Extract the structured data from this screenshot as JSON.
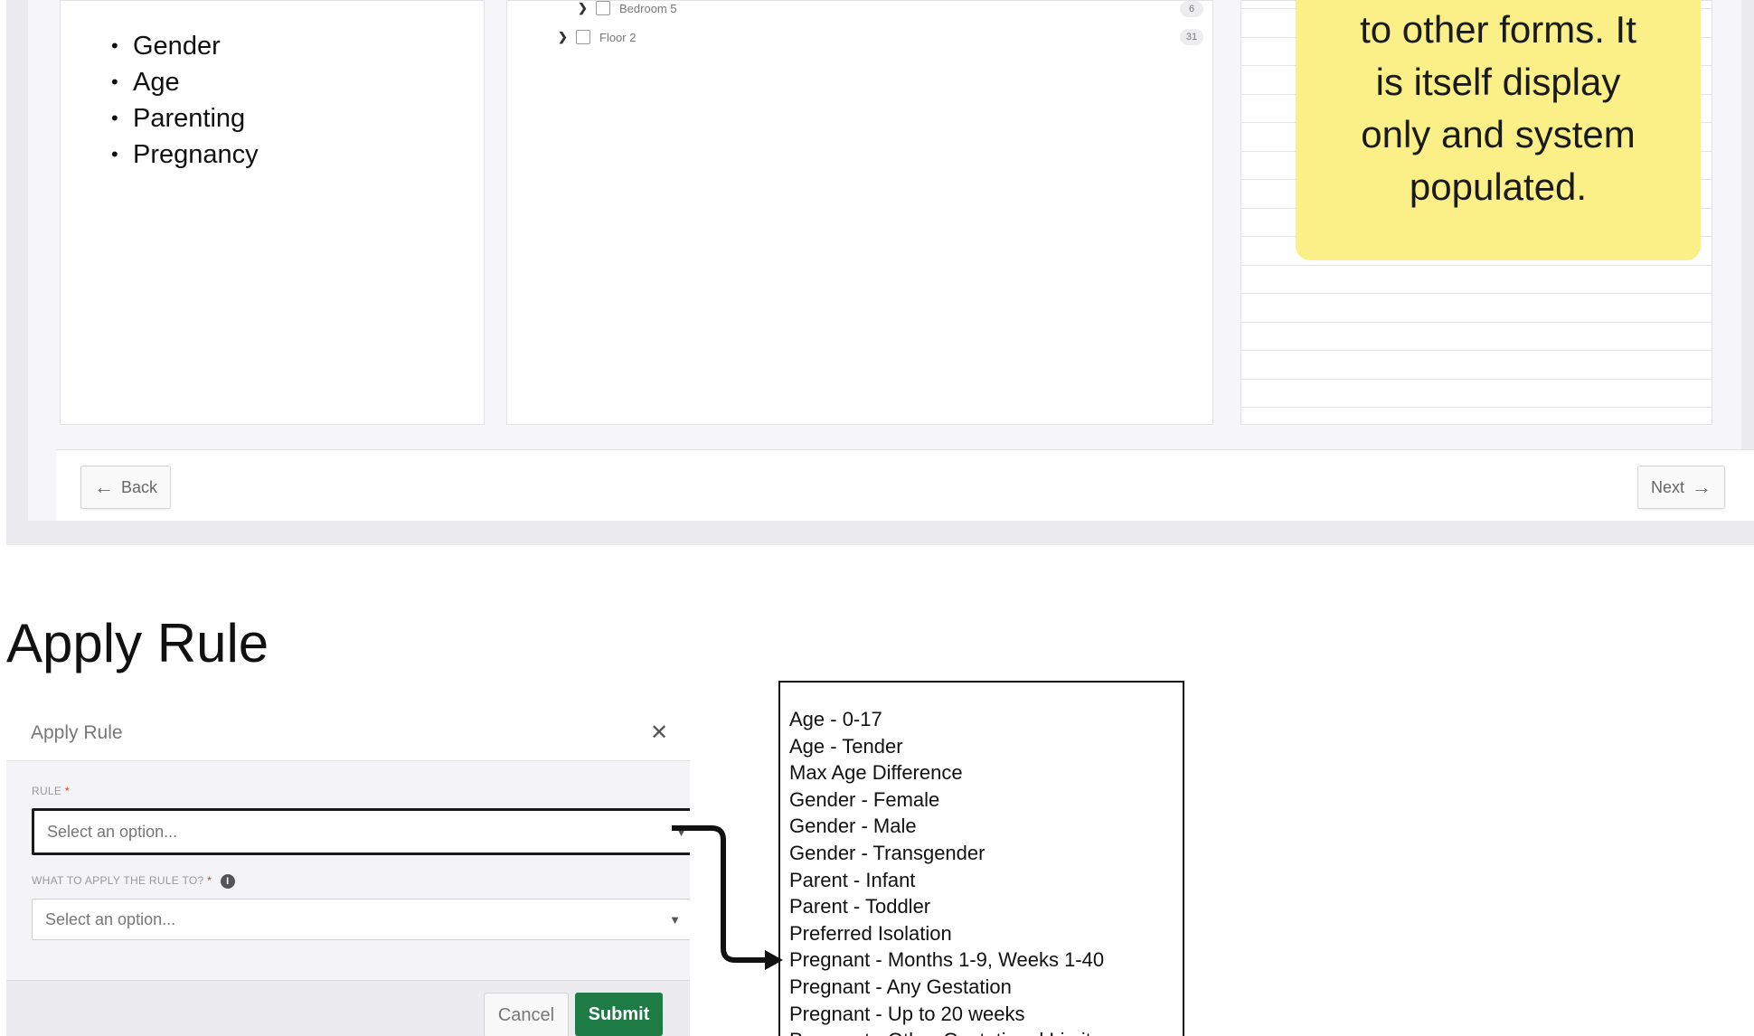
{
  "wizard": {
    "categories": [
      "Gender",
      "Age",
      "Parenting",
      "Pregnancy"
    ],
    "tree": [
      {
        "label": "Bedroom 5",
        "count": "6"
      },
      {
        "label": "Floor 2",
        "count": "31"
      }
    ],
    "sticky_note": {
      "lines": [
        "to other forms. It",
        "is itself display",
        "only and system",
        "populated."
      ],
      "color": "#faf087"
    },
    "back_label": "Back",
    "next_label": "Next"
  },
  "section_title": "Apply Rule",
  "dialog": {
    "title": "Apply Rule",
    "rule_label": "RULE",
    "rule_placeholder": "Select an option...",
    "target_label": "WHAT TO APPLY THE RULE TO?",
    "target_placeholder": "Select an option...",
    "required_mark": "*",
    "cancel_label": "Cancel",
    "submit_label": "Submit",
    "submit_color": "#1e7b45"
  },
  "rule_options": [
    "Age - 0-17",
    "Age - Tender",
    "Max Age Difference",
    "Gender - Female",
    "Gender - Male",
    "Gender - Transgender",
    "Parent - Infant",
    "Parent - Toddler",
    "Preferred Isolation",
    "Pregnant - Months 1-9, Weeks 1-40",
    "Pregnant - Any Gestation",
    "Pregnant - Up to 20 weeks",
    "Pregnant - Other Gestational Limits"
  ]
}
